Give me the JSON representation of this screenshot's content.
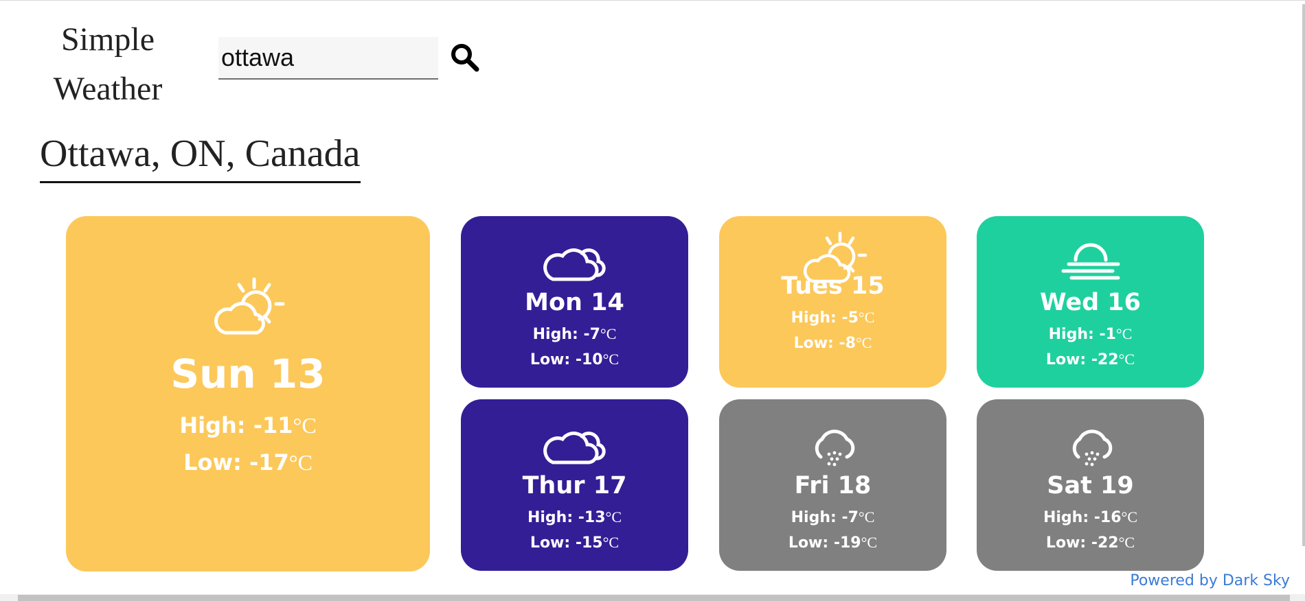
{
  "app": {
    "brand_line1": "Simple",
    "brand_line2": "Weather",
    "accent_link_color": "#3a7bd5"
  },
  "search": {
    "value": "ottawa",
    "placeholder": "",
    "button_icon": "search-icon"
  },
  "location": {
    "name": "Ottawa, ON, Canada"
  },
  "colors": {
    "sunny": "#FCC85A",
    "cloudy": "#341E96",
    "fog": "#1FD09F",
    "snow": "#808080"
  },
  "forecast": [
    {
      "day": "Sun 13",
      "high": "High: -11",
      "low": "Low: -17",
      "unit": "°C",
      "icon": "partly-cloudy-day-icon",
      "color": "#FCC85A"
    },
    {
      "day": "Mon 14",
      "high": "High: -7",
      "low": "Low: -10",
      "unit": "°C",
      "icon": "cloudy-icon",
      "color": "#341E96"
    },
    {
      "day": "Tues 15",
      "high": "High: -5",
      "low": "Low: -8",
      "unit": "°C",
      "icon": "partly-cloudy-day-icon",
      "color": "#FCC85A"
    },
    {
      "day": "Wed 16",
      "high": "High: -1",
      "low": "Low: -22",
      "unit": "°C",
      "icon": "fog-icon",
      "color": "#1FD09F"
    },
    {
      "day": "Thur 17",
      "high": "High: -13",
      "low": "Low: -15",
      "unit": "°C",
      "icon": "cloudy-icon",
      "color": "#341E96"
    },
    {
      "day": "Fri 18",
      "high": "High: -7",
      "low": "Low: -19",
      "unit": "°C",
      "icon": "snow-icon",
      "color": "#808080"
    },
    {
      "day": "Sat 19",
      "high": "High: -16",
      "low": "Low: -22",
      "unit": "°C",
      "icon": "snow-icon",
      "color": "#808080"
    }
  ],
  "footer": {
    "credit": "Powered by Dark Sky"
  }
}
